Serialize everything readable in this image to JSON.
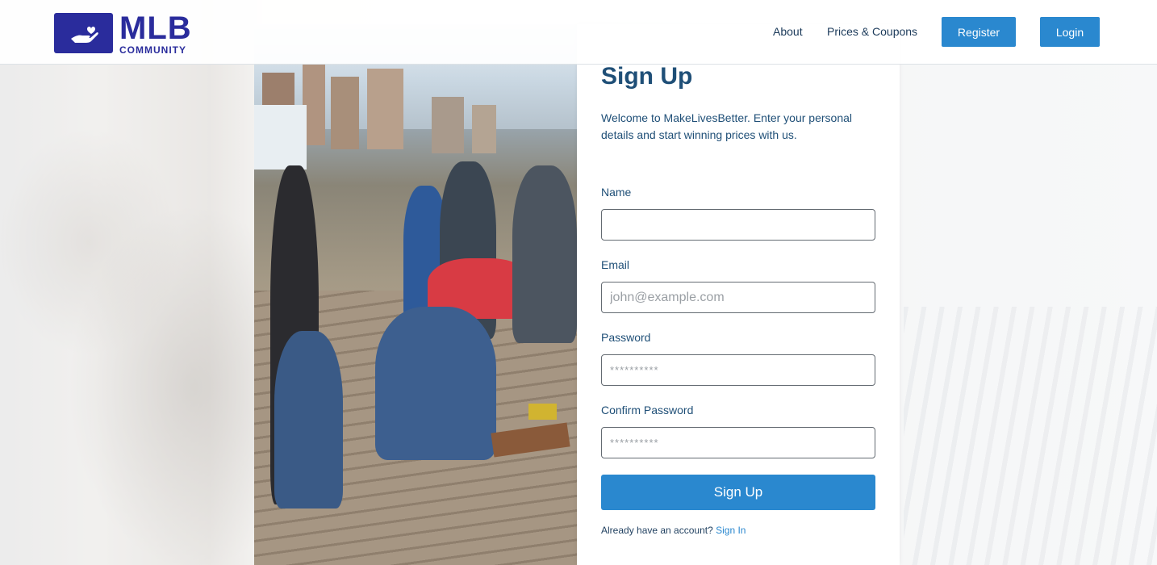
{
  "brand": {
    "name": "MLB",
    "sub": "COMMUNITY"
  },
  "nav": {
    "about": "About",
    "prices": "Prices & Coupons",
    "register": "Register",
    "login": "Login"
  },
  "colors": {
    "brand": "#2a2c9c",
    "accent": "#2a88cf",
    "heading": "#1f4f77"
  },
  "signup": {
    "title": "Sign Up",
    "intro": "Welcome to MakeLivesBetter. Enter your personal details and start winning prices with us.",
    "fields": {
      "name": {
        "label": "Name",
        "value": "",
        "placeholder": ""
      },
      "email": {
        "label": "Email",
        "value": "",
        "placeholder": "john@example.com"
      },
      "password": {
        "label": "Password",
        "value": "",
        "placeholder": "**********"
      },
      "confirm": {
        "label": "Confirm Password",
        "value": "",
        "placeholder": "**********"
      }
    },
    "submit": "Sign Up",
    "have_account": "Already have an account?",
    "sign_in": "Sign In"
  },
  "icons": {
    "logo": "hand-heart-icon"
  }
}
